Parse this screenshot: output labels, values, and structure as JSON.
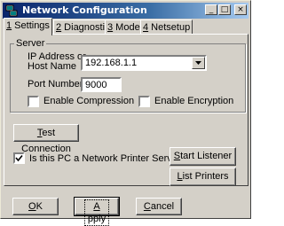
{
  "window": {
    "title": "Network Configuration",
    "minimize": "_",
    "maximize": "□",
    "close": "×"
  },
  "tabs": [
    {
      "key": "1",
      "label": " Settings"
    },
    {
      "key": "2",
      "label": " Diagnostics"
    },
    {
      "key": "3",
      "label": " Mode"
    },
    {
      "key": "4",
      "label": " Netsetup"
    }
  ],
  "server_group": {
    "label": "Server",
    "ip_label_line1": "IP Address or",
    "ip_label_line2": "Host Name",
    "ip_value": "192.168.1.1",
    "port_label": "Port Number",
    "port_value": "9000",
    "compression_label": "Enable Compression",
    "compression_checked": false,
    "encryption_label": "Enable Encryption",
    "encryption_checked": false
  },
  "test_connection": {
    "mnemonic": "T",
    "rest": "est Connection"
  },
  "printer_server": {
    "label": "Is this PC a Network Printer Server?",
    "checked": true
  },
  "start_listener": {
    "mnemonic": "S",
    "rest": "tart Listener"
  },
  "list_printers": {
    "mnemonic": "L",
    "rest": "ist Printers"
  },
  "footer": {
    "ok": {
      "mnemonic": "O",
      "rest": "K"
    },
    "apply": {
      "mnemonic": "A",
      "rest": "pply"
    },
    "cancel": {
      "mnemonic": "C",
      "rest": "ancel"
    }
  }
}
